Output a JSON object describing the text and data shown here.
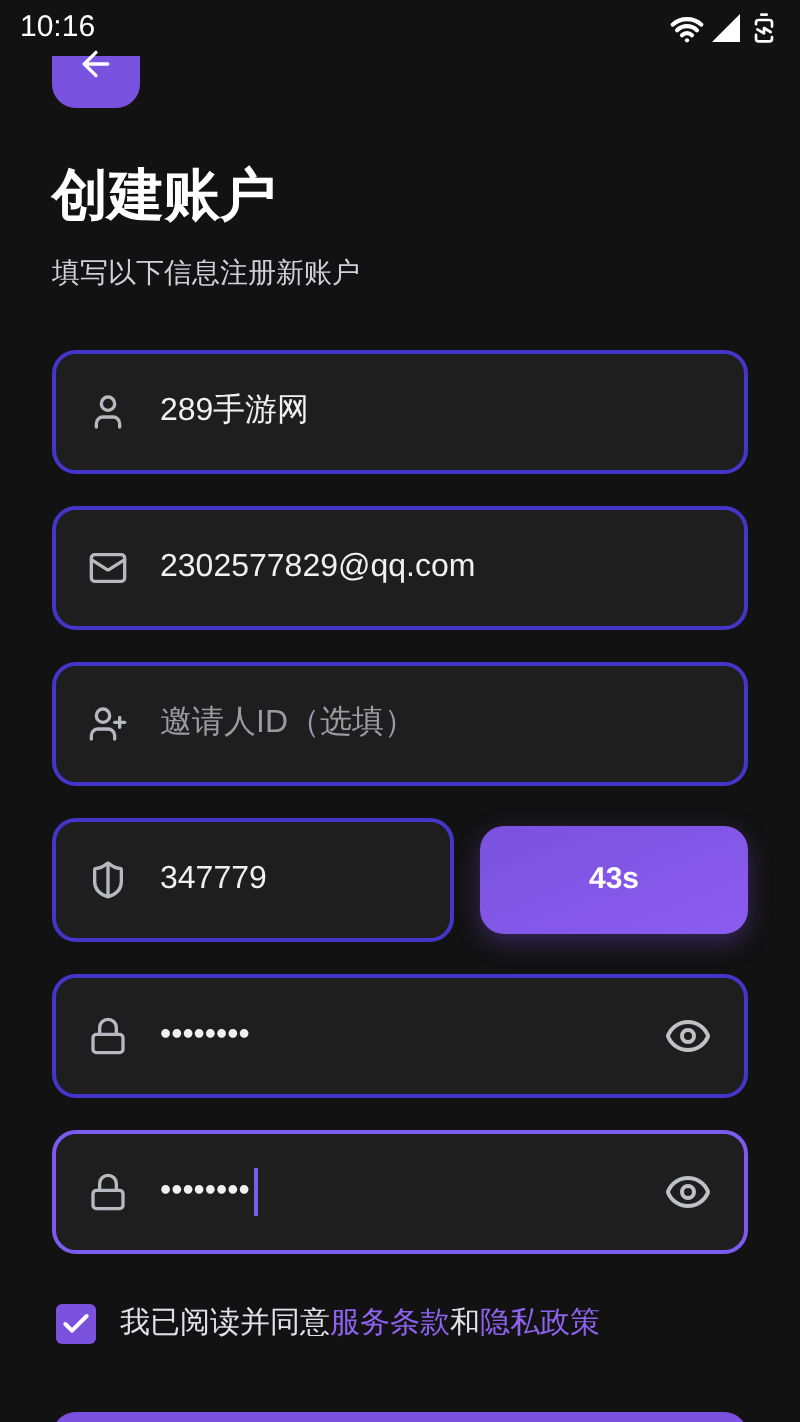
{
  "status_bar": {
    "time": "10:16"
  },
  "title": "创建账户",
  "subtitle": "填写以下信息注册新账户",
  "fields": [
    {
      "kind": "user",
      "value": "289手游网",
      "focused": false
    },
    {
      "kind": "email",
      "value": "2302577829@qq.com",
      "focused": false
    },
    {
      "kind": "invite",
      "placeholder": "邀请人ID（选填）",
      "focused": false
    }
  ],
  "code_field": {
    "value": "347779",
    "focused": false
  },
  "code_button": {
    "label": "43s"
  },
  "password_fields": [
    {
      "value": "••••••••",
      "focused": false
    },
    {
      "value": "••••••••",
      "focused": true
    }
  ],
  "agreement": {
    "checked": true,
    "parts": [
      {
        "kind": "text",
        "text": "我已阅读并同意"
      },
      {
        "kind": "link",
        "text": "服务条款"
      },
      {
        "kind": "text",
        "text": "和"
      },
      {
        "kind": "link",
        "text": "隐私政策"
      }
    ]
  }
}
